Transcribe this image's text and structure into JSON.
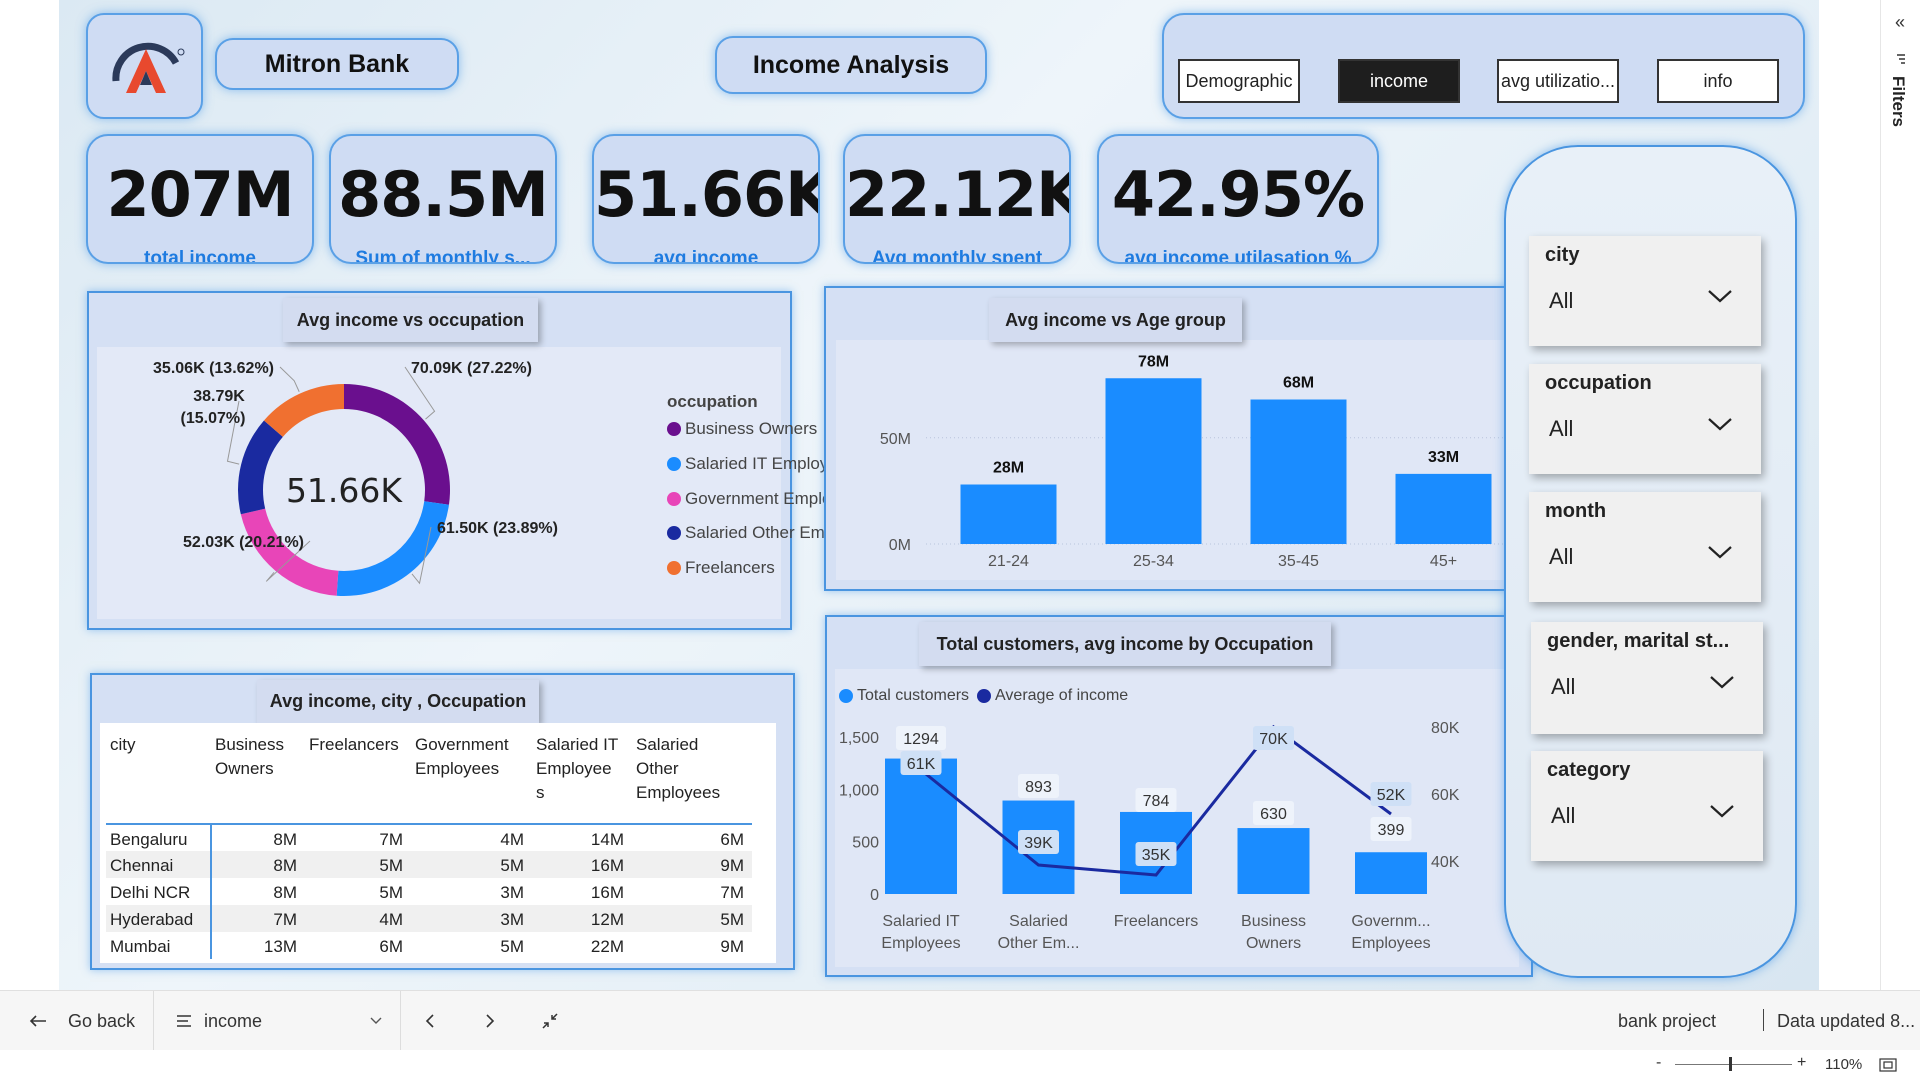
{
  "header": {
    "bank_name": "Mitron Bank",
    "page_title": "Income Analysis",
    "nav_buttons": [
      {
        "label": "Demographic",
        "active": false
      },
      {
        "label": "income",
        "active": true
      },
      {
        "label": "avg utilizatio...",
        "active": false
      },
      {
        "label": "info",
        "active": false
      }
    ]
  },
  "kpis": [
    {
      "value": "207M",
      "label": "total income"
    },
    {
      "value": "88.5M",
      "label": "Sum of monthly s..."
    },
    {
      "value": "51.66K",
      "label": "avg income"
    },
    {
      "value": "22.12K",
      "label": "Avg monthly spent"
    },
    {
      "value": "42.95%",
      "label": "avg income utilasation %"
    }
  ],
  "donut": {
    "title": "Avg income vs occupation",
    "center_value": "51.66K",
    "legend_title": "occupation",
    "slices": [
      {
        "name": "Business Owners",
        "legend_label": "Business Owners",
        "value": 70.09,
        "label": "70.09K (27.22%)",
        "color": "#6a0f8e"
      },
      {
        "name": "Salaried IT Employees",
        "legend_label": "Salaried IT Employe...",
        "value": 61.5,
        "label": "61.50K (23.89%)",
        "color": "#1a8cff"
      },
      {
        "name": "Government Employees",
        "legend_label": "Government Emplo...",
        "value": 52.03,
        "label": "52.03K (20.21%)",
        "color": "#e845b8"
      },
      {
        "name": "Salaried Other Employees",
        "legend_label": "Salaried Other Emp...",
        "value": 38.79,
        "label_line1": "38.79K",
        "label_line2": "(15.07%)",
        "color": "#1a2aa0"
      },
      {
        "name": "Freelancers",
        "legend_label": "Freelancers",
        "value": 35.06,
        "label": "35.06K (13.62%)",
        "color": "#f07030"
      }
    ]
  },
  "age_chart": {
    "title": "Avg income vs Age group",
    "y_ticks": [
      "50M",
      "0M"
    ],
    "chart_data": {
      "type": "bar",
      "categories": [
        "21-24",
        "25-34",
        "35-45",
        "45+"
      ],
      "values": [
        28,
        78,
        68,
        33
      ],
      "data_labels": [
        "28M",
        "78M",
        "68M",
        "33M"
      ],
      "ylim": [
        0,
        80
      ],
      "color": "#1a8cff"
    }
  },
  "table": {
    "title": "Avg income, city , Occupation",
    "headers": [
      "city",
      "Business\nOwners",
      "Freelancers",
      "Government\nEmployees",
      "Salaried IT\nEmployee\ns",
      "Salaried\nOther\nEmployees"
    ],
    "rows": [
      [
        "Bengaluru",
        "8M",
        "7M",
        "4M",
        "14M",
        "6M"
      ],
      [
        "Chennai",
        "8M",
        "5M",
        "5M",
        "16M",
        "9M"
      ],
      [
        "Delhi NCR",
        "8M",
        "5M",
        "3M",
        "16M",
        "7M"
      ],
      [
        "Hyderabad",
        "7M",
        "4M",
        "3M",
        "12M",
        "5M"
      ],
      [
        "Mumbai",
        "13M",
        "6M",
        "5M",
        "22M",
        "9M"
      ]
    ]
  },
  "combo_chart": {
    "title": "Total customers, avg income by Occupation",
    "legend": [
      {
        "label": "Total customers",
        "color": "#1a8cff"
      },
      {
        "label": "Average of income",
        "color": "#1a2aa0"
      }
    ],
    "y_left_ticks": [
      "1,500",
      "1,000",
      "500",
      "0"
    ],
    "y_right_ticks": [
      "80K",
      "60K",
      "40K"
    ],
    "chart_data": {
      "type": "bar",
      "categories": [
        "Salaried IT\nEmployees",
        "Salaried\nOther Em...",
        "Freelancers",
        "Business\nOwners",
        "Governm...\nEmployees"
      ],
      "series": [
        {
          "name": "Total customers",
          "values": [
            1294,
            893,
            784,
            630,
            399
          ],
          "labels": [
            "1294",
            "893",
            "784",
            "630",
            "399"
          ]
        },
        {
          "name": "Average of income",
          "values": [
            61,
            39,
            35,
            70,
            52
          ],
          "labels": [
            "61K",
            "39K",
            "35K",
            "70K",
            "52K"
          ]
        }
      ],
      "ylim_left": [
        0,
        1500
      ],
      "ylim_right": [
        40,
        80
      ]
    }
  },
  "slicers": [
    {
      "label": "city",
      "value": "All"
    },
    {
      "label": "occupation",
      "value": "All"
    },
    {
      "label": "month",
      "value": "All"
    },
    {
      "label": "gender, marital st...",
      "value": "All"
    },
    {
      "label": "category",
      "value": "All"
    }
  ],
  "bottom_bar": {
    "go_back": "Go back",
    "page_select": "income",
    "report_name": "bank project",
    "data_updated": "Data updated 8..."
  },
  "zoom": {
    "minus": "-",
    "plus": "+",
    "level": "110%"
  },
  "filters_rail": {
    "label": "Filters",
    "collapse_glyph": "«"
  }
}
